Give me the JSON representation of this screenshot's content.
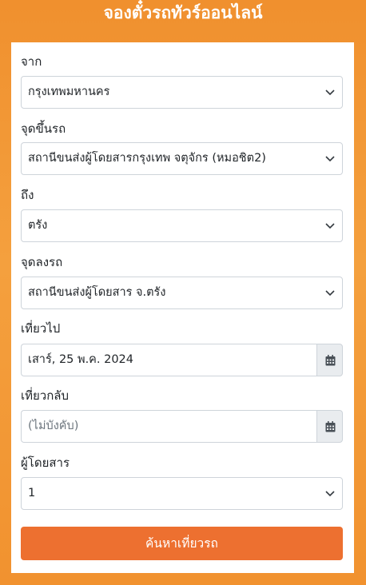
{
  "header": {
    "title": "จองตั๋วรถทัวร์ออนไลน์"
  },
  "form": {
    "origin": {
      "label": "จาก",
      "value": "กรุงเทพมหานคร"
    },
    "boarding_point": {
      "label": "จุดขึ้นรถ",
      "value": "สถานีขนส่งผู้โดยสารกรุงเทพ จตุจักร (หมอชิต2)"
    },
    "destination": {
      "label": "ถึง",
      "value": "ตรัง"
    },
    "dropoff_point": {
      "label": "จุดลงรถ",
      "value": "สถานีขนส่งผู้โดยสาร จ.ตรัง"
    },
    "depart_date": {
      "label": "เที่ยวไป",
      "value": "เสาร์, 25 พ.ค. 2024"
    },
    "return_date": {
      "label": "เที่ยวกลับ",
      "placeholder": "(ไม่บังคับ)"
    },
    "passengers": {
      "label": "ผู้โดยสาร",
      "value": "1"
    },
    "search_label": "ค้นหาเที่ยวรถ"
  },
  "icons": {
    "select_arrow": "chevron-down-icon",
    "date_picker": "calendar-icon"
  },
  "colors": {
    "background": "#f39433",
    "button": "#ed7030",
    "panel": "#ffffff"
  }
}
